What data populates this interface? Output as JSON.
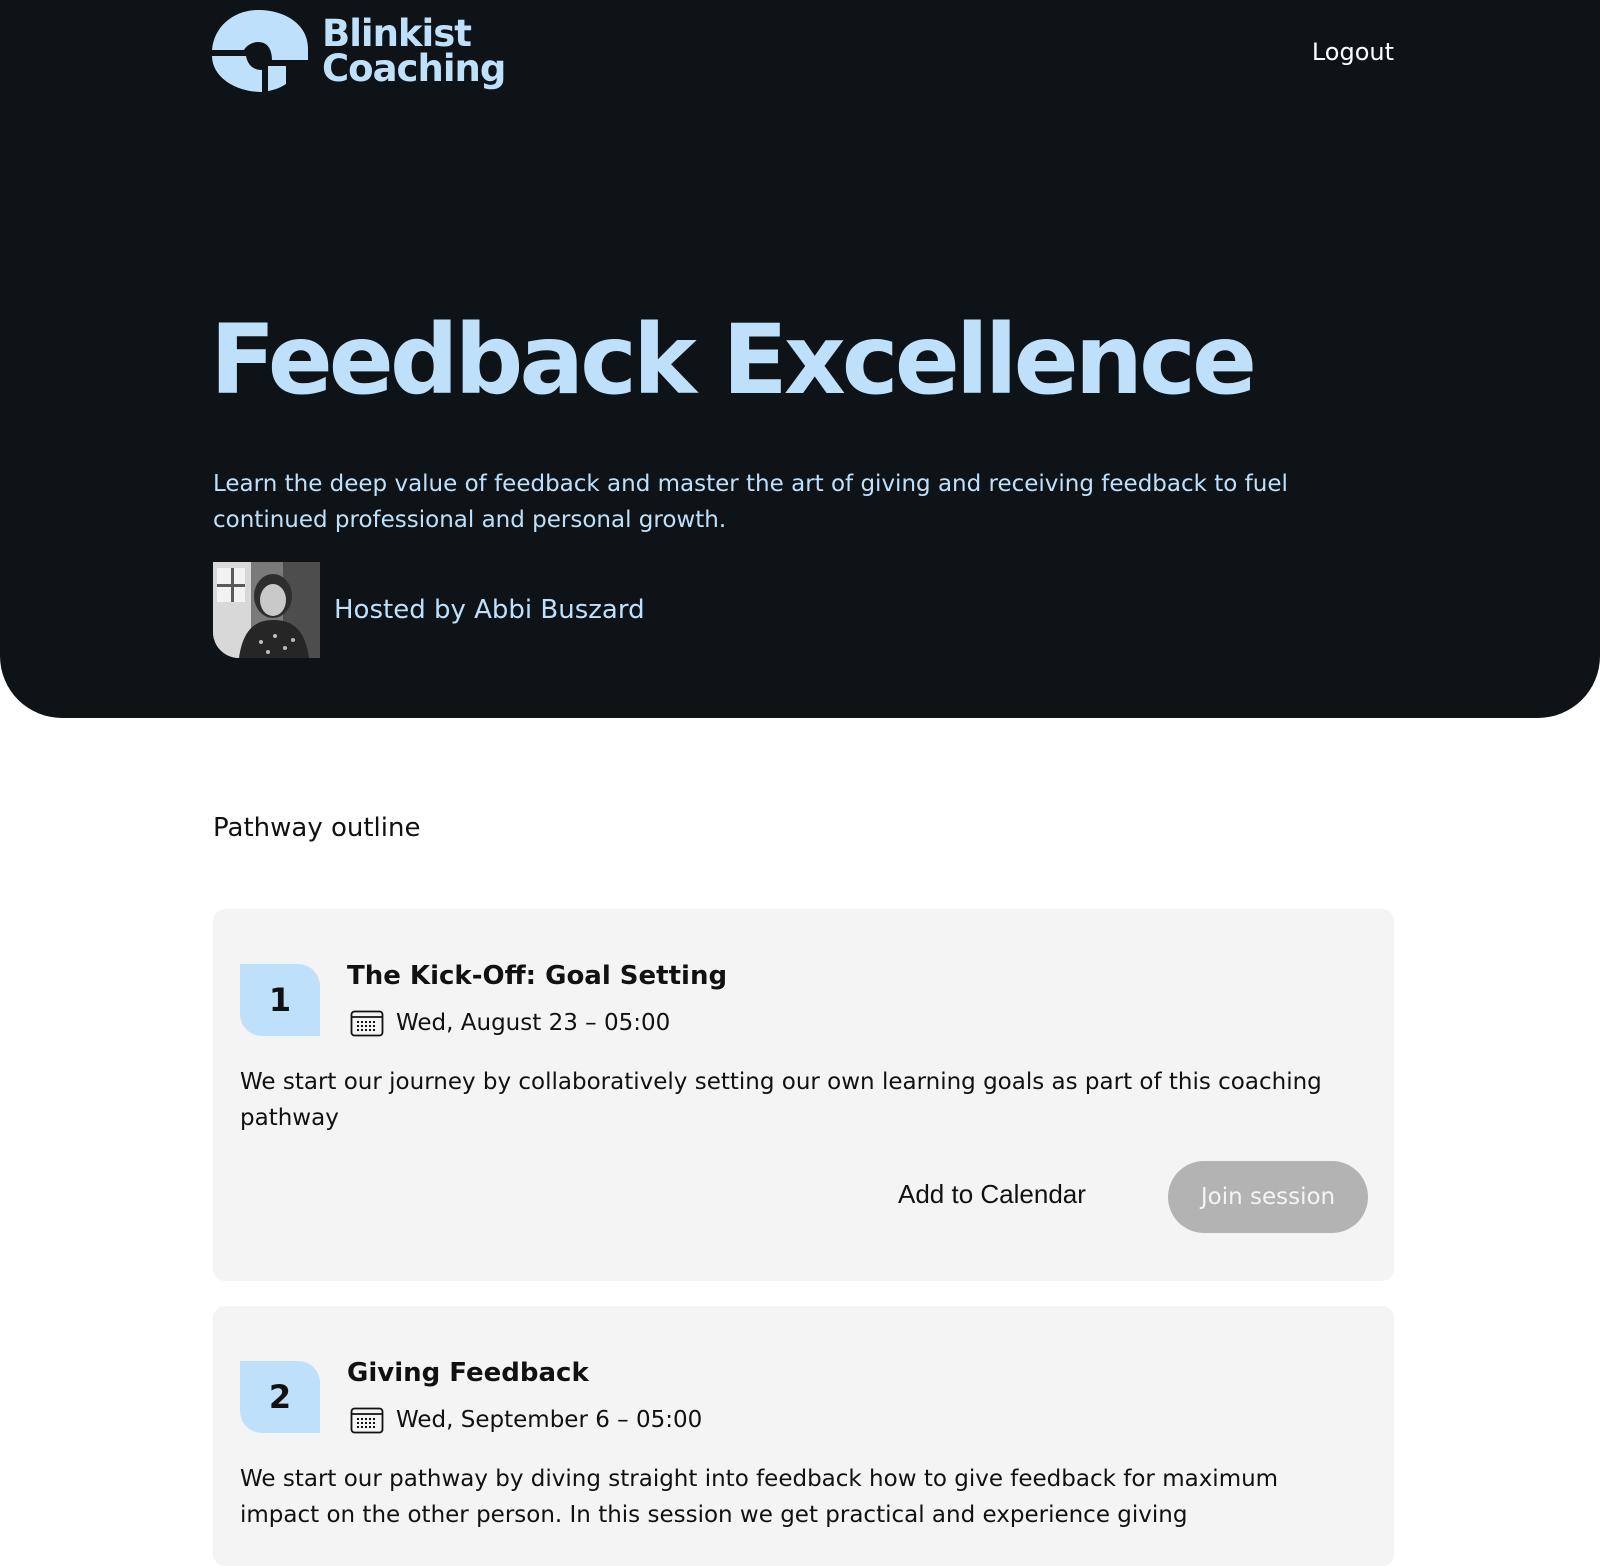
{
  "header": {
    "logo_line1": "Blinkist",
    "logo_line2": "Coaching",
    "logout_label": "Logout"
  },
  "hero": {
    "title": "Feedback Excellence",
    "description": "Learn the deep value of feedback and master the art of giving and receiving feedback to fuel continued professional and personal growth.",
    "host_text": "Hosted by Abbi Buszard"
  },
  "outline": {
    "heading": "Pathway outline",
    "sessions": [
      {
        "number": "1",
        "title": "The Kick-Off: Goal Setting",
        "date": "Wed, August 23 – 05:00",
        "description": "We start our journey by collaboratively setting our own learning goals as part of this coaching pathway",
        "add_calendar_label": "Add to Calendar",
        "join_label": "Join session"
      },
      {
        "number": "2",
        "title": "Giving Feedback",
        "date": "Wed, September 6 – 05:00",
        "description": "We start our pathway by diving straight into feedback how to give feedback for maximum impact on the other person. In this session we get practical and experience giving"
      }
    ]
  },
  "colors": {
    "hero_bg": "#0e1318",
    "accent_light_blue": "#bfe0fa",
    "card_bg": "#f4f4f4",
    "disabled_button": "#b3b3b3"
  }
}
